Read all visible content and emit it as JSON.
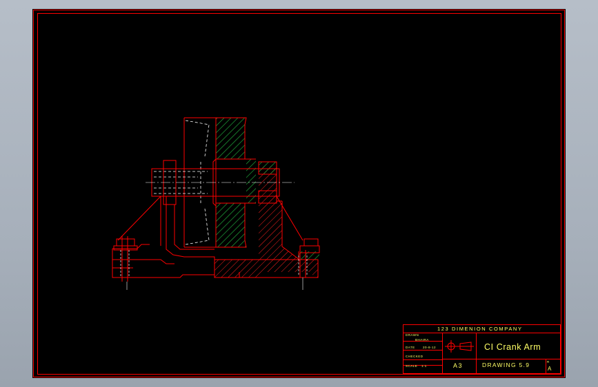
{
  "title_block": {
    "company": "123 DIMENION COMPANY",
    "drawn_label": "DRAWN",
    "drawn_by": "BHAIRA",
    "date_label": "DATE",
    "date_value": "20-8-12",
    "checked_label": "CHECKED",
    "scale_label": "SCALE",
    "scale_value": "1:1",
    "title": "CI Crank Arm",
    "sheet_size": "A3",
    "drawing_number": "DRAWING 5.9",
    "revision_label": "R",
    "revision": "A"
  },
  "colors": {
    "background": "#000000",
    "border": "#ff0000",
    "outline": "#ff0000",
    "hidden": "#ffffff",
    "hatch_red": "#ff2020",
    "hatch_green": "#1fa83a",
    "text": "#ffff66"
  }
}
